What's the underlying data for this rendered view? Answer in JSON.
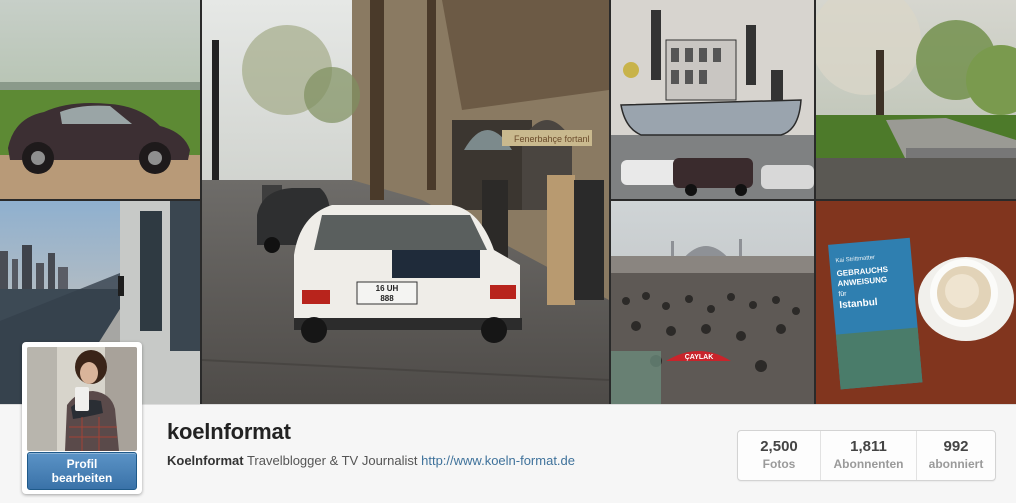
{
  "profile": {
    "username": "koelnformat",
    "display_name": "Koelnformat",
    "bio_text": "Travelblogger & TV Journalist",
    "website": "http://www.koeln-format.de",
    "edit_button_line1": "Profil",
    "edit_button_line2": "bearbeiten"
  },
  "stats": [
    {
      "value": "2,500",
      "label": "Fotos"
    },
    {
      "value": "1,811",
      "label": "Abonnenten"
    },
    {
      "value": "992",
      "label": "abonniert"
    }
  ],
  "mosaic": {
    "street_plate_line1": "16 UH",
    "street_plate_line2": "888",
    "street_shop_sign": "Fenerbahçe fortanl",
    "book_small_text": "Kai Strittmatter",
    "book_title_1": "GEBRAUCHS",
    "book_title_2": "ANWEISUNG",
    "book_title_3": "für",
    "book_title_4": "Istanbul",
    "crowd_sign": "ÇAYLAK"
  },
  "colors": {
    "link": "#3f729b",
    "button": "#3a72a8"
  }
}
